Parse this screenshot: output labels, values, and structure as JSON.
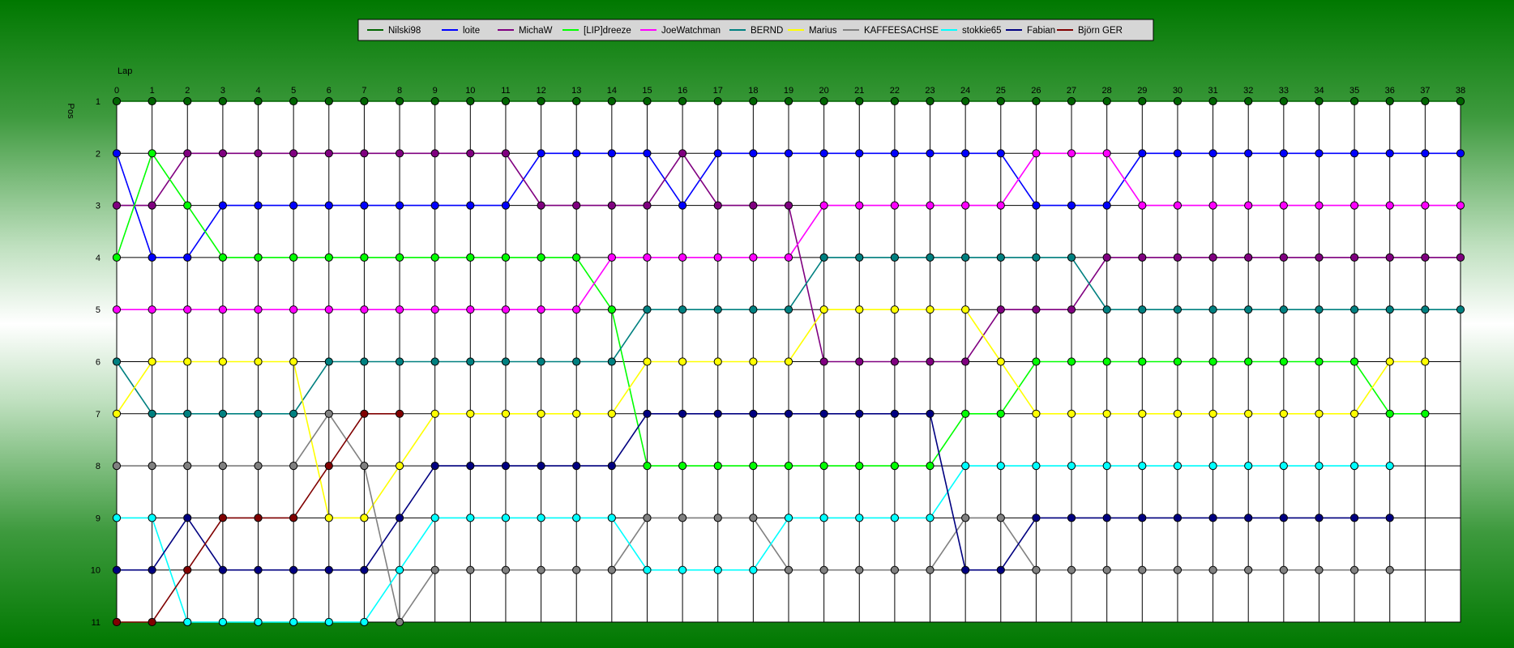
{
  "chart_data": {
    "type": "line",
    "xlabel": "Lap",
    "ylabel": "Pos",
    "x_ticks": [
      0,
      1,
      2,
      3,
      4,
      5,
      6,
      7,
      8,
      9,
      10,
      11,
      12,
      13,
      14,
      15,
      16,
      17,
      18,
      19,
      20,
      21,
      22,
      23,
      24,
      25,
      26,
      27,
      28,
      29,
      30,
      31,
      32,
      33,
      34,
      35,
      36,
      37,
      38
    ],
    "y_ticks": [
      1,
      2,
      3,
      4,
      5,
      6,
      7,
      8,
      9,
      10,
      11
    ],
    "xlim": [
      0,
      38
    ],
    "ylim": [
      1,
      11
    ],
    "y_inverted": true,
    "grid": true,
    "legend_position": "top-center",
    "series": [
      {
        "name": "Nilski98",
        "color": "#006400",
        "values": [
          1,
          1,
          1,
          1,
          1,
          1,
          1,
          1,
          1,
          1,
          1,
          1,
          1,
          1,
          1,
          1,
          1,
          1,
          1,
          1,
          1,
          1,
          1,
          1,
          1,
          1,
          1,
          1,
          1,
          1,
          1,
          1,
          1,
          1,
          1,
          1,
          1,
          1,
          1
        ]
      },
      {
        "name": "loite",
        "color": "#0000ff",
        "values": [
          2,
          4,
          4,
          3,
          3,
          3,
          3,
          3,
          3,
          3,
          3,
          3,
          2,
          2,
          2,
          2,
          3,
          2,
          2,
          2,
          2,
          2,
          2,
          2,
          2,
          2,
          3,
          3,
          3,
          2,
          2,
          2,
          2,
          2,
          2,
          2,
          2,
          2,
          2
        ]
      },
      {
        "name": "MichaW",
        "color": "#800080",
        "values": [
          3,
          3,
          2,
          2,
          2,
          2,
          2,
          2,
          2,
          2,
          2,
          2,
          3,
          3,
          3,
          3,
          2,
          3,
          3,
          3,
          6,
          6,
          6,
          6,
          6,
          5,
          5,
          5,
          4,
          4,
          4,
          4,
          4,
          4,
          4,
          4,
          4,
          4,
          4
        ]
      },
      {
        "name": "[LIP]dreeze",
        "color": "#00ff00",
        "values": [
          4,
          2,
          3,
          4,
          4,
          4,
          4,
          4,
          4,
          4,
          4,
          4,
          4,
          4,
          5,
          8,
          8,
          8,
          8,
          8,
          8,
          8,
          8,
          8,
          7,
          7,
          6,
          6,
          6,
          6,
          6,
          6,
          6,
          6,
          6,
          6,
          7,
          7
        ]
      },
      {
        "name": "JoeWatchman",
        "color": "#ff00ff",
        "values": [
          5,
          5,
          5,
          5,
          5,
          5,
          5,
          5,
          5,
          5,
          5,
          5,
          5,
          5,
          4,
          4,
          4,
          4,
          4,
          4,
          3,
          3,
          3,
          3,
          3,
          3,
          2,
          2,
          2,
          3,
          3,
          3,
          3,
          3,
          3,
          3,
          3,
          3,
          3
        ]
      },
      {
        "name": "BERND",
        "color": "#008080",
        "values": [
          6,
          7,
          7,
          7,
          7,
          7,
          6,
          6,
          6,
          6,
          6,
          6,
          6,
          6,
          6,
          5,
          5,
          5,
          5,
          5,
          4,
          4,
          4,
          4,
          4,
          4,
          4,
          4,
          5,
          5,
          5,
          5,
          5,
          5,
          5,
          5,
          5,
          5,
          5
        ]
      },
      {
        "name": "Marius",
        "color": "#ffff00",
        "values": [
          7,
          6,
          6,
          6,
          6,
          6,
          9,
          9,
          8,
          7,
          7,
          7,
          7,
          7,
          7,
          6,
          6,
          6,
          6,
          6,
          5,
          5,
          5,
          5,
          5,
          6,
          7,
          7,
          7,
          7,
          7,
          7,
          7,
          7,
          7,
          7,
          6,
          6
        ]
      },
      {
        "name": "KAFFEESACHSE",
        "color": "#808080",
        "values": [
          8,
          8,
          8,
          8,
          8,
          8,
          7,
          8,
          11,
          10,
          10,
          10,
          10,
          10,
          10,
          9,
          9,
          9,
          9,
          10,
          10,
          10,
          10,
          10,
          9,
          9,
          10,
          10,
          10,
          10,
          10,
          10,
          10,
          10,
          10,
          10,
          10
        ]
      },
      {
        "name": "stokkie65",
        "color": "#00ffff",
        "values": [
          9,
          9,
          11,
          11,
          11,
          11,
          11,
          11,
          10,
          9,
          9,
          9,
          9,
          9,
          9,
          10,
          10,
          10,
          10,
          9,
          9,
          9,
          9,
          9,
          8,
          8,
          8,
          8,
          8,
          8,
          8,
          8,
          8,
          8,
          8,
          8,
          8
        ]
      },
      {
        "name": "Fabian",
        "color": "#000080",
        "values": [
          10,
          10,
          9,
          10,
          10,
          10,
          10,
          10,
          9,
          8,
          8,
          8,
          8,
          8,
          8,
          7,
          7,
          7,
          7,
          7,
          7,
          7,
          7,
          7,
          10,
          10,
          9,
          9,
          9,
          9,
          9,
          9,
          9,
          9,
          9,
          9,
          9
        ]
      },
      {
        "name": "Björn GER",
        "color": "#800000",
        "values": [
          11,
          11,
          10,
          9,
          9,
          9,
          8,
          7,
          7
        ]
      }
    ]
  }
}
